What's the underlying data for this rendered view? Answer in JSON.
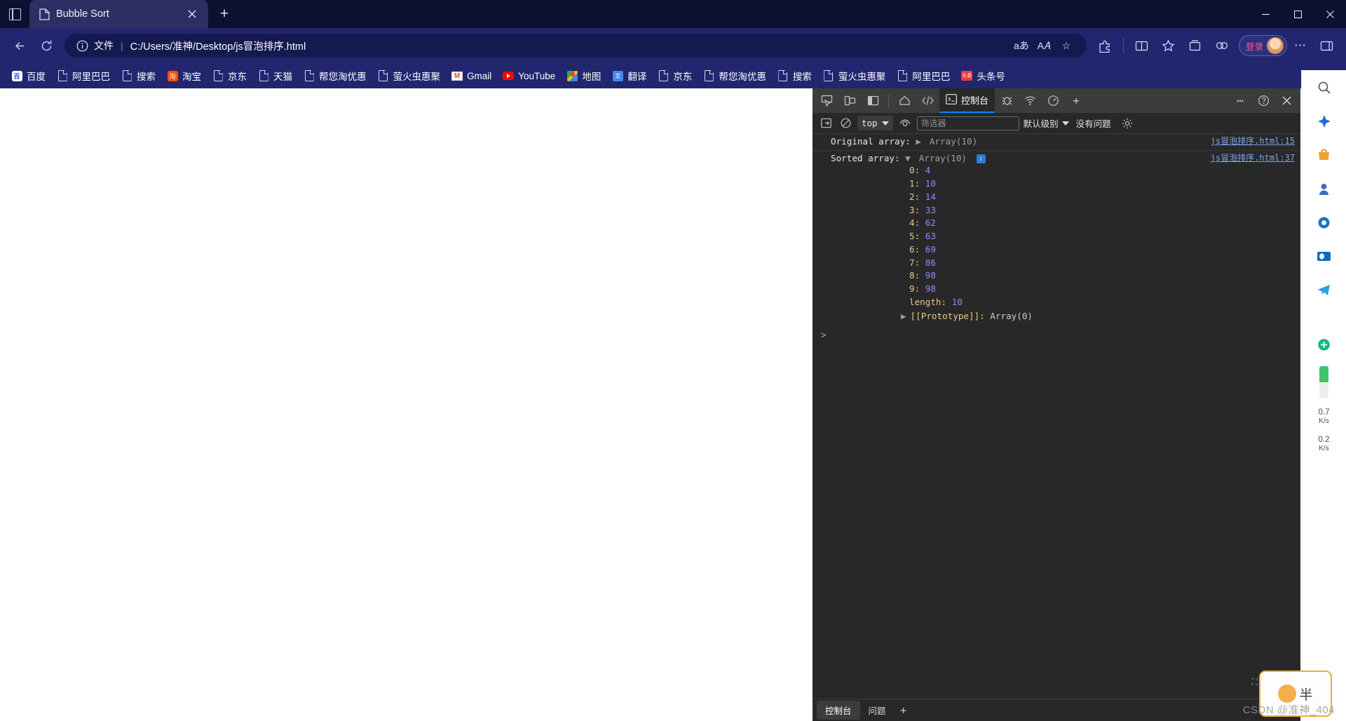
{
  "window": {
    "minimize_label": "—",
    "maximize_label": "▢",
    "close_label": "✕",
    "tab_list_icon": "tab-list-icon"
  },
  "tab": {
    "title": "Bubble Sort",
    "close_label": "✕",
    "newtab_label": "+"
  },
  "nav": {
    "back_label": "←",
    "reload_label": "⟳",
    "omnibox": {
      "info_label": "ⓘ",
      "scheme_label": "文件",
      "separator": "|",
      "url": "C:/Users/准神/Desktop/js冒泡排序.html",
      "read_aloud_label": "aあ",
      "translate_label": "A𝐴",
      "favorite_label": "☆"
    },
    "buttons": [
      {
        "name": "extensions-icon",
        "label": "⧉"
      },
      {
        "name": "split-screen-icon",
        "label": "▯▯"
      },
      {
        "name": "favorites-icon",
        "label": "☆"
      },
      {
        "name": "collections-icon",
        "label": "⊞"
      },
      {
        "name": "browser-essentials-icon",
        "label": "♡"
      }
    ],
    "profile": {
      "text": "登录",
      "avatar": "user-avatar"
    },
    "settings_label": "⋯",
    "sidebar_toggle_label": "◫"
  },
  "bookmarks": [
    {
      "label": "百度",
      "icon": "baidu-favicon"
    },
    {
      "label": "阿里巴巴",
      "icon": "doc-favicon"
    },
    {
      "label": "搜索",
      "icon": "doc-favicon"
    },
    {
      "label": "淘宝",
      "icon": "taobao-favicon"
    },
    {
      "label": "京东",
      "icon": "doc-favicon"
    },
    {
      "label": "天猫",
      "icon": "doc-favicon"
    },
    {
      "label": "帮您淘优惠",
      "icon": "doc-favicon"
    },
    {
      "label": "萤火虫惠聚",
      "icon": "doc-favicon"
    },
    {
      "label": "Gmail",
      "icon": "gmail-favicon"
    },
    {
      "label": "YouTube",
      "icon": "youtube-favicon"
    },
    {
      "label": "地图",
      "icon": "maps-favicon"
    },
    {
      "label": "翻译",
      "icon": "translate-favicon"
    },
    {
      "label": "京东",
      "icon": "doc-favicon"
    },
    {
      "label": "帮您淘优惠",
      "icon": "doc-favicon"
    },
    {
      "label": "搜索",
      "icon": "doc-favicon"
    },
    {
      "label": "萤火虫惠聚",
      "icon": "doc-favicon"
    },
    {
      "label": "阿里巴巴",
      "icon": "doc-favicon"
    },
    {
      "label": "头条号",
      "icon": "toutiao-favicon"
    }
  ],
  "devtools": {
    "toolbar": {
      "inspect_icon": "inspect-element-icon",
      "device_icon": "device-toolbar-icon",
      "dock_icon": "dock-side-icon",
      "home_icon": "home-icon",
      "elements_icon": "elements-code-icon",
      "console_tab": "控制台",
      "console_icon": "console-terminal-icon",
      "sources_icon": "bug-icon",
      "network_icon": "network-icon",
      "performance_icon": "performance-icon",
      "more_tabs_label": "+",
      "overflow_label": "⋯",
      "help_label": "?",
      "close_label": "✕"
    },
    "console_toolbar": {
      "sidebar_icon": "console-sidebar-icon",
      "clear_icon": "clear-console-icon",
      "context_value": "top",
      "eye_icon": "live-expression-icon",
      "filter_placeholder": "筛选器",
      "filter_value": "",
      "level_label": "默认级别",
      "issues_label": "没有问题",
      "settings_icon": "gear-icon"
    },
    "logs": [
      {
        "label": "Original array:",
        "expanded": false,
        "arrow": "▶",
        "preview": "Array(10)",
        "source": "js冒泡排序.html:15",
        "has_info_badge": false
      },
      {
        "label": "Sorted array:",
        "expanded": true,
        "arrow": "▼",
        "preview": "Array(10)",
        "source": "js冒泡排序.html:37",
        "has_info_badge": true,
        "info_badge": "i",
        "properties": [
          {
            "key": "0",
            "value": "4"
          },
          {
            "key": "1",
            "value": "10"
          },
          {
            "key": "2",
            "value": "14"
          },
          {
            "key": "3",
            "value": "33"
          },
          {
            "key": "4",
            "value": "62"
          },
          {
            "key": "5",
            "value": "63"
          },
          {
            "key": "6",
            "value": "69"
          },
          {
            "key": "7",
            "value": "86"
          },
          {
            "key": "8",
            "value": "98"
          },
          {
            "key": "9",
            "value": "98"
          },
          {
            "key": "length",
            "value": "10"
          }
        ],
        "prototype": {
          "arrow": "▶",
          "key": "[[Prototype]]:",
          "value": "Array(0)"
        }
      }
    ],
    "prompt_symbol": ">",
    "bottom_tabs": [
      {
        "label": "控制台",
        "active": true
      },
      {
        "label": "问题",
        "active": false
      }
    ],
    "bottom_plus": "+"
  },
  "edge_sidebar": [
    {
      "name": "search-icon",
      "glyph": "🔍"
    },
    {
      "name": "copilot-icon",
      "glyph": "◈"
    },
    {
      "name": "shopping-icon",
      "glyph": "🛍"
    },
    {
      "name": "games-icon",
      "glyph": "🎮"
    },
    {
      "name": "tools-icon",
      "glyph": "🔧"
    },
    {
      "name": "outlook-icon",
      "glyph": "✉"
    },
    {
      "name": "telegram-icon",
      "glyph": "✈"
    },
    {
      "name": "add-icon",
      "glyph": "+"
    }
  ],
  "network_meter": {
    "upload_rate": "0.7",
    "upload_unit": "K/s",
    "download_rate": "0.2",
    "download_unit": "K/s"
  },
  "watermark": {
    "text": "CSDN @准神_404"
  },
  "floating_widget": {
    "text": "半"
  }
}
